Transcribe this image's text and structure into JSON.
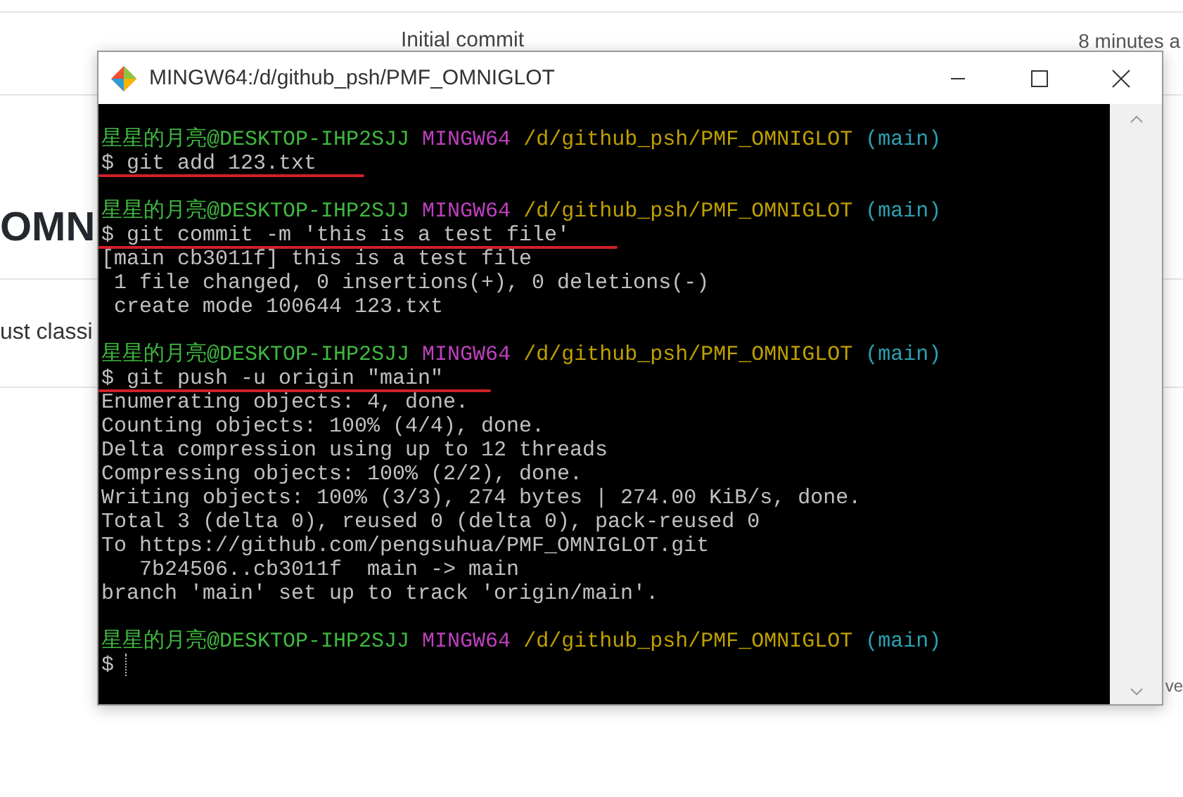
{
  "background_page": {
    "commit_message": "Initial commit",
    "commit_time": "8 minutes a",
    "heading": "OMN",
    "description": "ust classi",
    "side_text": "ve"
  },
  "window": {
    "title": "MINGW64:/d/github_psh/PMF_OMNIGLOT"
  },
  "terminal": {
    "lines": [
      {
        "kind": "prompt",
        "user": "星星的月亮@DESKTOP-IHP2SJJ",
        "system": "MINGW64",
        "path": "/d/github_psh/PMF_OMNIGLOT",
        "branch": "(main)"
      },
      {
        "kind": "command",
        "text": "$ git add 123.txt",
        "underlined": true
      },
      {
        "kind": "blank"
      },
      {
        "kind": "prompt",
        "user": "星星的月亮@DESKTOP-IHP2SJJ",
        "system": "MINGW64",
        "path": "/d/github_psh/PMF_OMNIGLOT",
        "branch": "(main)"
      },
      {
        "kind": "command",
        "text": "$ git commit -m 'this is a test file'",
        "underlined": true
      },
      {
        "kind": "output",
        "text": "[main cb3011f] this is a test file"
      },
      {
        "kind": "output",
        "text": " 1 file changed, 0 insertions(+), 0 deletions(-)"
      },
      {
        "kind": "output",
        "text": " create mode 100644 123.txt"
      },
      {
        "kind": "blank"
      },
      {
        "kind": "prompt",
        "user": "星星的月亮@DESKTOP-IHP2SJJ",
        "system": "MINGW64",
        "path": "/d/github_psh/PMF_OMNIGLOT",
        "branch": "(main)"
      },
      {
        "kind": "command",
        "text": "$ git push -u origin \"main\"",
        "underlined": true
      },
      {
        "kind": "output",
        "text": "Enumerating objects: 4, done."
      },
      {
        "kind": "output",
        "text": "Counting objects: 100% (4/4), done."
      },
      {
        "kind": "output",
        "text": "Delta compression using up to 12 threads"
      },
      {
        "kind": "output",
        "text": "Compressing objects: 100% (2/2), done."
      },
      {
        "kind": "output",
        "text": "Writing objects: 100% (3/3), 274 bytes | 274.00 KiB/s, done."
      },
      {
        "kind": "output",
        "text": "Total 3 (delta 0), reused 0 (delta 0), pack-reused 0"
      },
      {
        "kind": "output",
        "text": "To https://github.com/pengsuhua/PMF_OMNIGLOT.git"
      },
      {
        "kind": "output",
        "text": "   7b24506..cb3011f  main -> main"
      },
      {
        "kind": "output",
        "text": "branch 'main' set up to track 'origin/main'."
      },
      {
        "kind": "blank"
      },
      {
        "kind": "prompt",
        "user": "星星的月亮@DESKTOP-IHP2SJJ",
        "system": "MINGW64",
        "path": "/d/github_psh/PMF_OMNIGLOT",
        "branch": "(main)"
      },
      {
        "kind": "command",
        "text": "$",
        "underlined": false,
        "cursor": true
      }
    ]
  }
}
